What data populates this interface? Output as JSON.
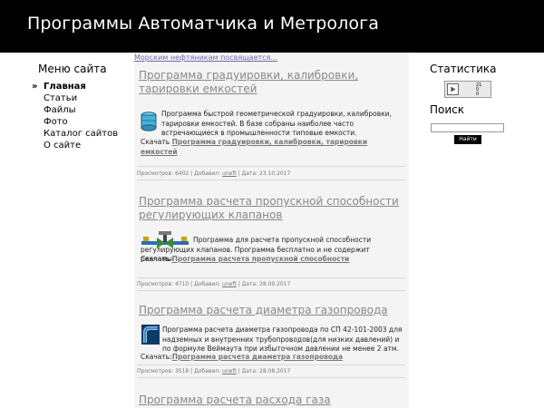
{
  "header": {
    "title": "Программы Автоматчика и Метролога"
  },
  "sidebar": {
    "title": "Меню сайта",
    "items": [
      {
        "label": "Главная",
        "active": true
      },
      {
        "label": "Статьи"
      },
      {
        "label": "Файлы"
      },
      {
        "label": "Фото"
      },
      {
        "label": "Каталог сайтов"
      },
      {
        "label": "О сайте"
      }
    ]
  },
  "main": {
    "marquee": "Морским нефтяникам посвящается...",
    "articles": [
      {
        "title": "Программа градуировки, калибровки, тарировки емкостей",
        "icon": "tank-icon",
        "body": "Программа быстрой геометрической градуировки, калибровки, тарировки емкостей.  В базе собраны наиболее часто встречающиеся в промышленности типовые емкости.",
        "download_prefix": "Скачать",
        "download_link": "Программа градуировки, калибровки, тарировки емкостей",
        "meta": {
          "views_label": "Просмотров:",
          "views": "6402",
          "added_label": "Добавил:",
          "author": "uneft",
          "date_label": "Дата:",
          "date": "23.10.2017"
        }
      },
      {
        "title": "Программа расчета пропускной способности регулирующих клапанов",
        "icon": "control-valve-icon",
        "body": "Программа для расчета пропускной способности регулирующих клапанов. Программа бесплатно и не содержит рекламы.",
        "download_prefix": "Скачать",
        "download_link": "Программа расчета пропускной способности",
        "meta": {
          "views_label": "Просмотров:",
          "views": "4710",
          "added_label": "Добавил:",
          "author": "uneft",
          "date_label": "Дата:",
          "date": "28.09.2017"
        }
      },
      {
        "title": "Программа расчета диаметра газопровода",
        "icon": "pipe-icon",
        "body": "Программа расчета диаметра газопровода по СП 42-101-2003  для надземных и внутренних трубопроводов(для низких давлений) и по формуле Веймаута при избыточном давлении не менее 2 атм.",
        "download_prefix": "Скачать:",
        "download_link": "Программа расчета диаметра газопровода",
        "meta": {
          "views_label": "Просмотров:",
          "views": "3518",
          "added_label": "Добавил:",
          "author": "uneft",
          "date_label": "Дата:",
          "date": "28.08.2017"
        }
      },
      {
        "title": "Программа расчета расхода газа"
      }
    ]
  },
  "right": {
    "stats_title": "Статистика",
    "counter": {
      "line1": "21",
      "line2": "0",
      "line3": "0"
    },
    "search_title": "Поиск",
    "search_value": "",
    "search_button": "Найти"
  }
}
